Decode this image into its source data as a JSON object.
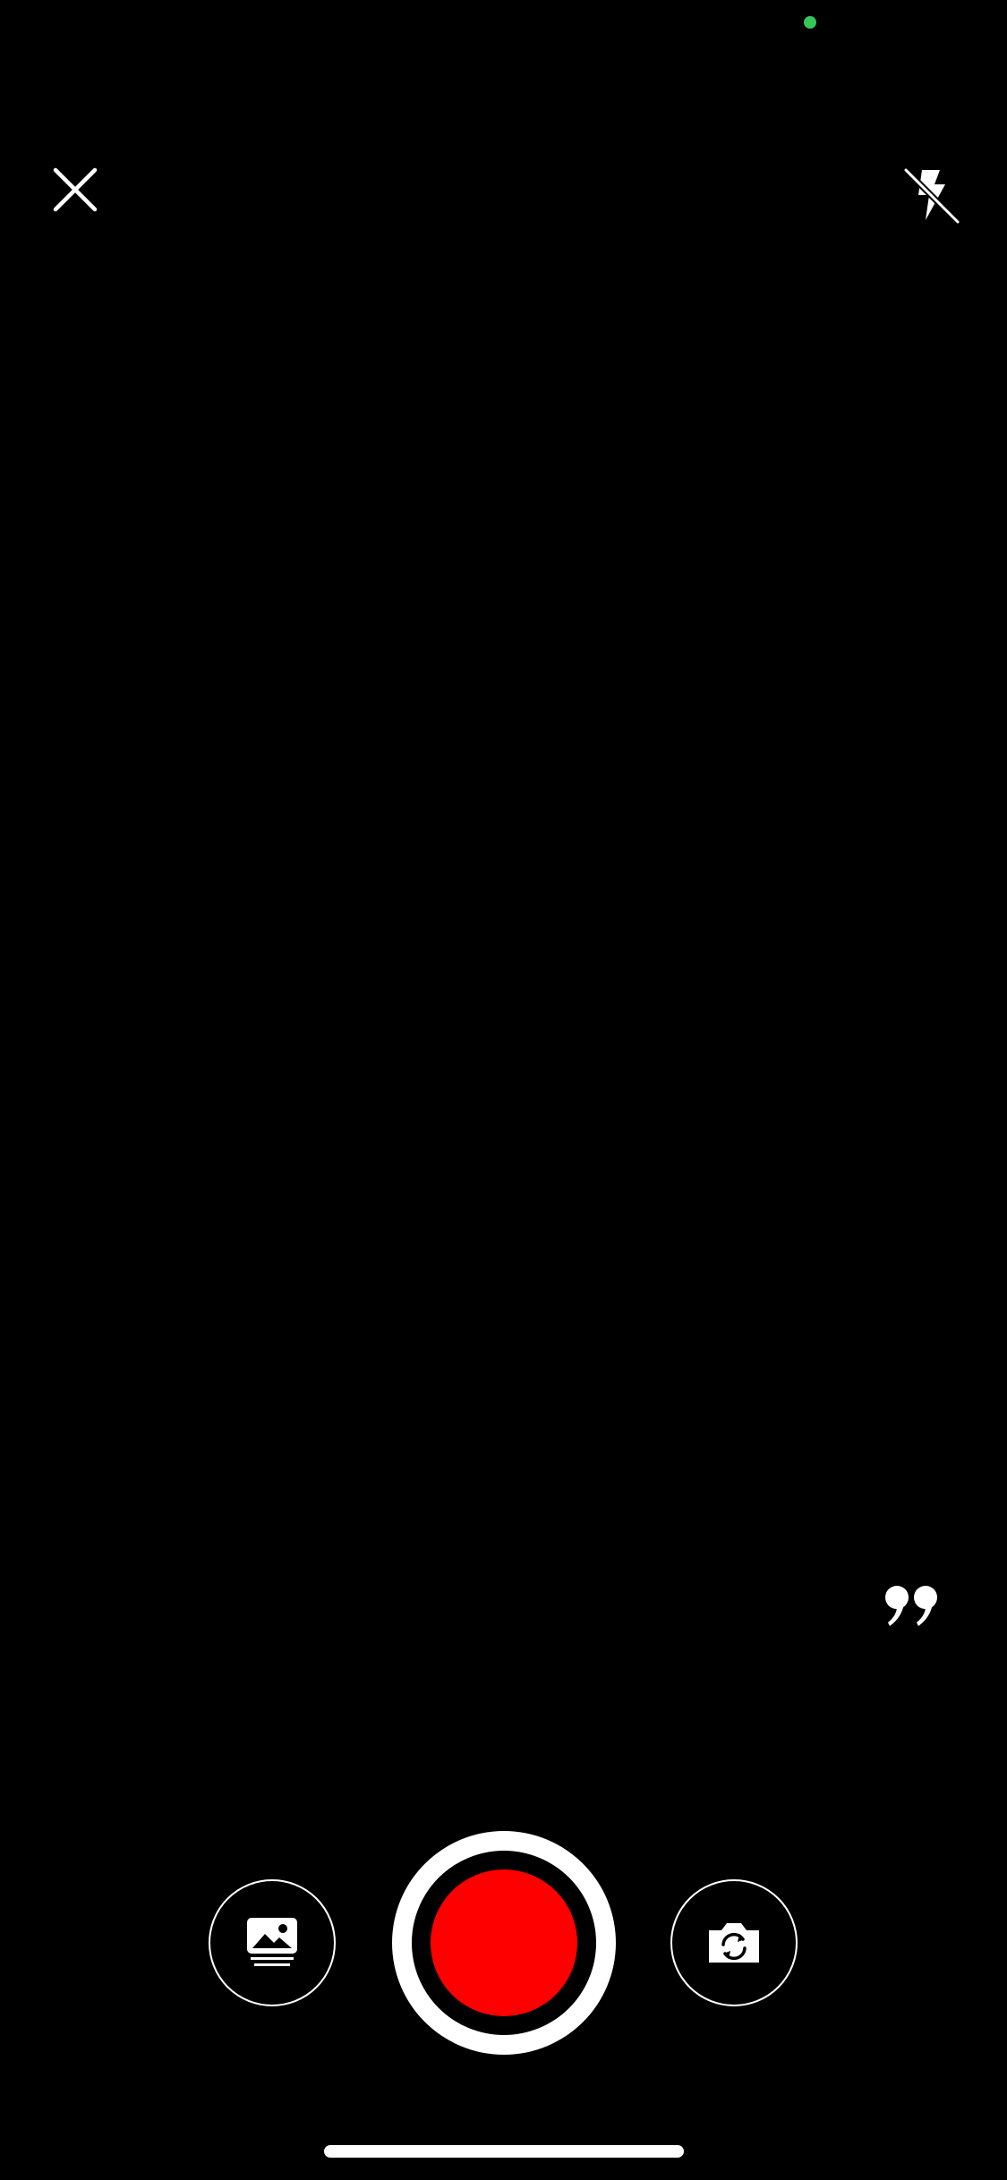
{
  "colors": {
    "background": "#000000",
    "foreground": "#ffffff",
    "record": "#ff0000",
    "privacy_dot": "#34c759"
  },
  "icons": {
    "close": "close-icon",
    "flash": "flash-off-icon",
    "quote": "quote-icon",
    "gallery": "gallery-icon",
    "record": "record-icon",
    "flip": "flip-camera-icon"
  }
}
